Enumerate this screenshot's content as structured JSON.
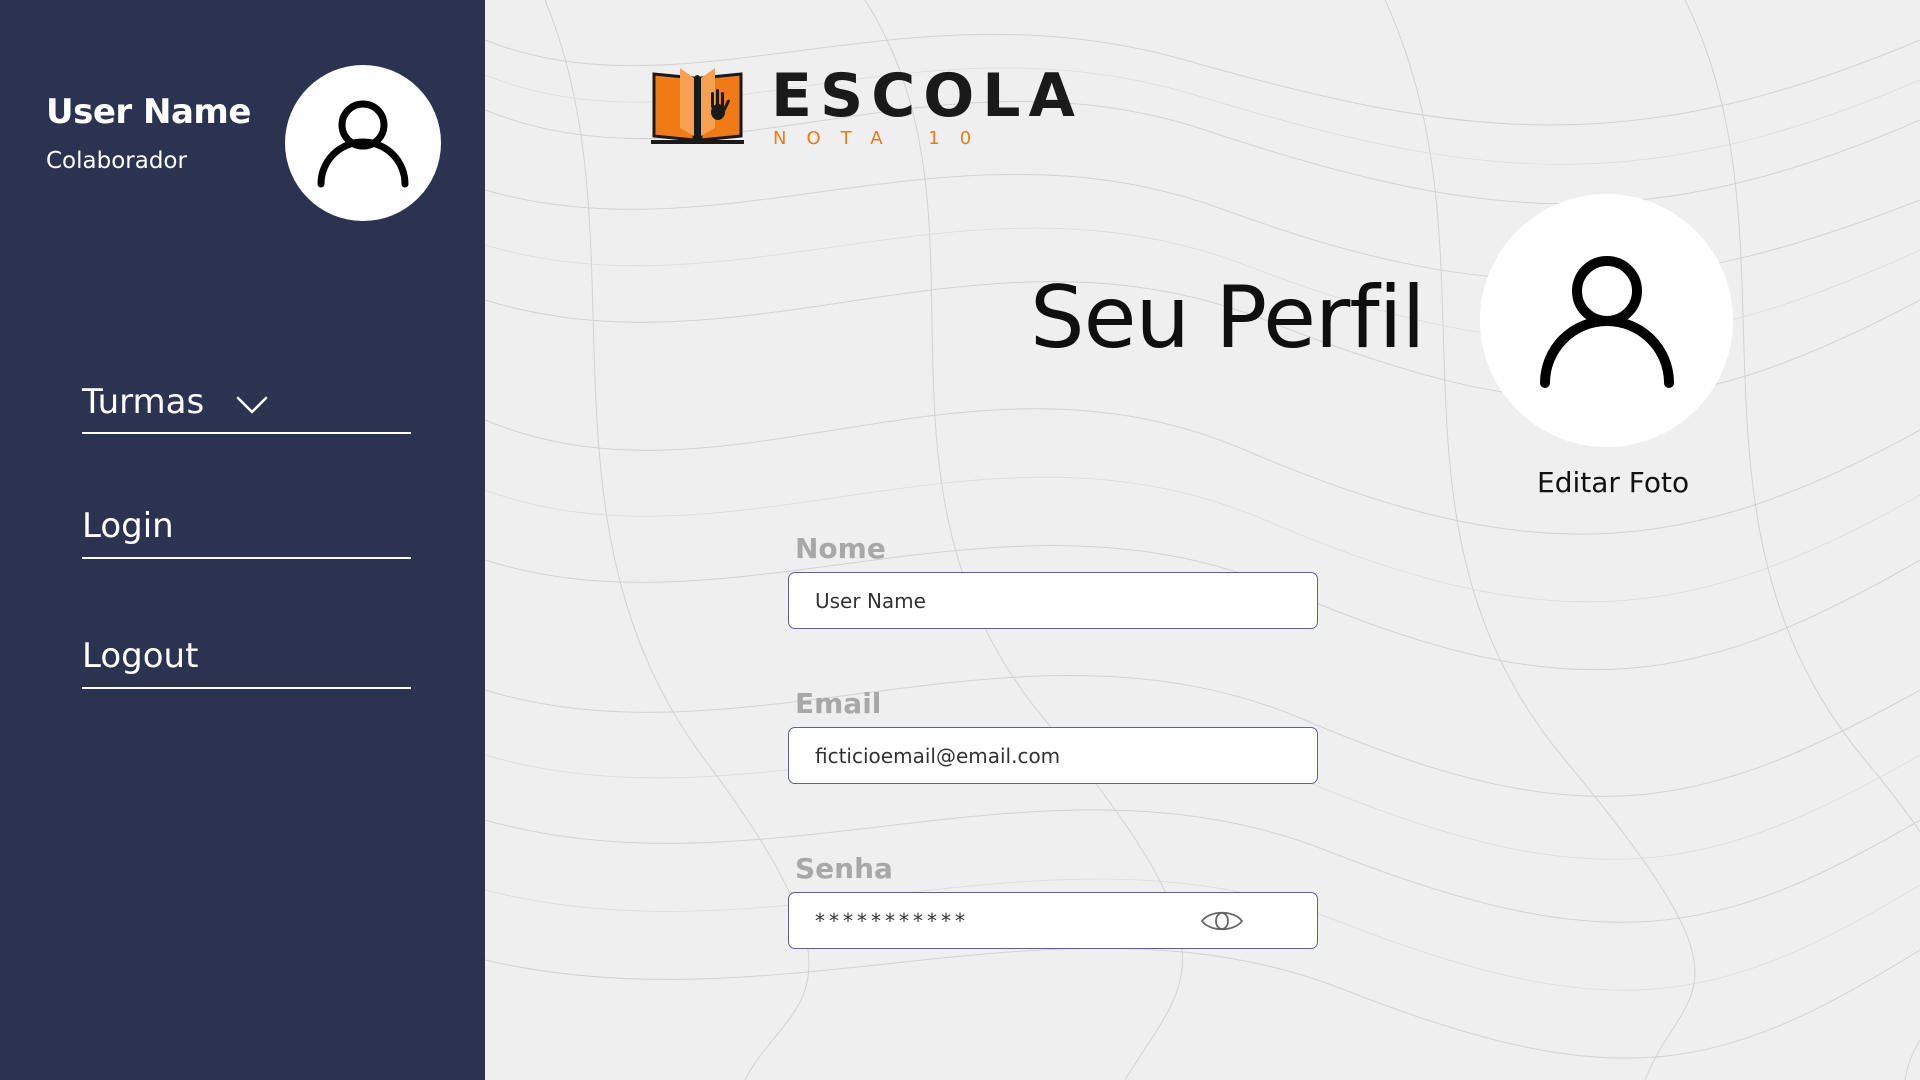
{
  "sidebar": {
    "user_name": "User Name",
    "user_role": "Colaborador",
    "avatar_icon": "user-icon",
    "nav": [
      {
        "label": "Turmas",
        "icon": "chevron-down-icon"
      },
      {
        "label": "Login"
      },
      {
        "label": "Logout"
      }
    ]
  },
  "logo": {
    "title": "ESCOLA",
    "subtitle": "NOTA 10",
    "icon": "book-hand-icon",
    "accent_color": "#f07a16"
  },
  "profile": {
    "title": "Seu Perfil",
    "avatar_icon": "user-icon",
    "edit_photo_label": "Editar Foto"
  },
  "form": {
    "name_label": "Nome",
    "name_value": "User Name",
    "email_label": "Email",
    "email_value": "ficticioemail@email.com",
    "password_label": "Senha",
    "password_mask": "***********",
    "password_toggle_icon": "eye-icon"
  },
  "colors": {
    "sidebar_bg": "#2c3350",
    "page_bg": "#efefef",
    "input_border": "#5a6393",
    "label_gray": "#a8a8a8"
  }
}
